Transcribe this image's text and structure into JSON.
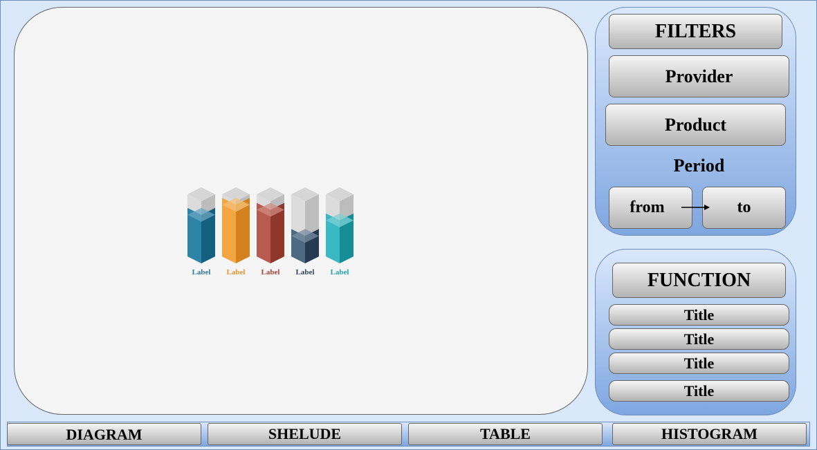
{
  "filters": {
    "title": "FILTERS",
    "provider": "Provider",
    "product": "Product",
    "period_label": "Period",
    "from": "from",
    "to": "to"
  },
  "function_panel": {
    "title": "FUNCTION",
    "items": [
      "Title",
      "Title",
      "Title",
      "Title"
    ]
  },
  "tabs": [
    "DIAGRAM",
    "SHELUDE",
    "TABLE",
    "HISTOGRAM"
  ],
  "chart_data": {
    "type": "bar",
    "categories": [
      "Label",
      "Label",
      "Label",
      "Label",
      "Label"
    ],
    "values": [
      0.67,
      0.83,
      0.75,
      0.33,
      0.58
    ],
    "ylim": [
      0,
      1
    ],
    "colors": [
      {
        "front": "#2e83a8",
        "side": "#14607f",
        "top": "#6aa6c2",
        "label": "#2e7aa0"
      },
      {
        "front": "#f2a541",
        "side": "#d4821e",
        "top": "#f5c27a",
        "label": "#e8932d"
      },
      {
        "front": "#b85a4e",
        "side": "#8e372b",
        "top": "#d08c83",
        "label": "#a84436"
      },
      {
        "front": "#4e6a82",
        "side": "#263b53",
        "top": "#7a8fa1",
        "label": "#2f435a"
      },
      {
        "front": "#3ab8c3",
        "side": "#168e98",
        "top": "#7dd0d6",
        "label": "#22a3ad"
      }
    ]
  }
}
